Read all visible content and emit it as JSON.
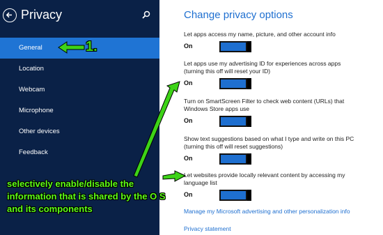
{
  "sidebar": {
    "title": "Privacy",
    "items": [
      {
        "label": "General"
      },
      {
        "label": "Location"
      },
      {
        "label": "Webcam"
      },
      {
        "label": "Microphone"
      },
      {
        "label": "Other devices"
      },
      {
        "label": "Feedback"
      }
    ],
    "active_index": 0
  },
  "main": {
    "title": "Change privacy options",
    "settings": [
      {
        "text": "Let apps access my name, picture, and other account info",
        "state": "On"
      },
      {
        "text": "Let apps use my advertising ID for experiences across apps (turning this off will reset your ID)",
        "state": "On"
      },
      {
        "text": "Turn on SmartScreen Filter to check web content (URLs) that Windows Store apps use",
        "state": "On"
      },
      {
        "text": "Show text suggestions based on what I type and write on this PC (turning this off will reset suggestions)",
        "state": "On"
      },
      {
        "text": "Let websites provide locally relevant content by accessing my language list",
        "state": "On"
      }
    ],
    "links": {
      "manage": "Manage my Microsoft advertising and other personalization info",
      "privacy_statement": "Privacy statement"
    }
  },
  "annotation": {
    "number": "1.",
    "text": "selectively enable/disable the information that is shared by the O S and its components"
  },
  "icons": [
    "back-arrow-icon",
    "search-icon"
  ],
  "colors": {
    "sidebar_bg": "#0a2147",
    "active_item": "#1f74d4",
    "accent": "#1e6fd0",
    "annotation": "#3dd317"
  }
}
